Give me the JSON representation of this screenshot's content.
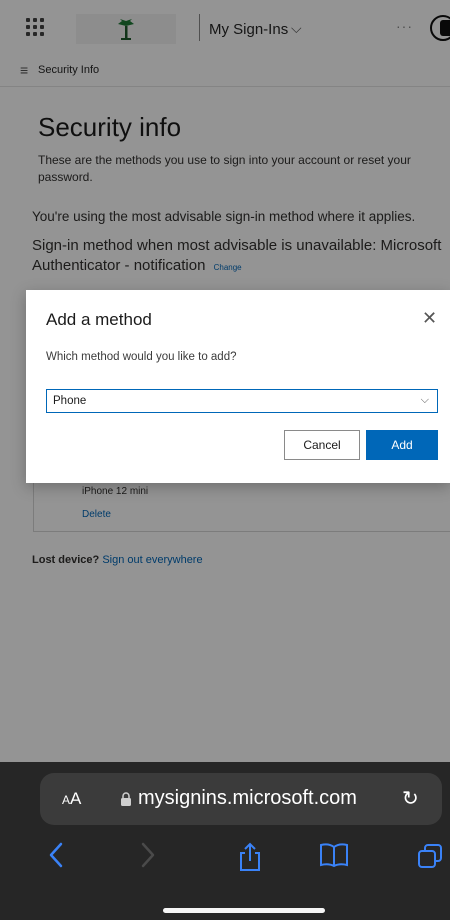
{
  "topbar": {
    "app_title": "My Sign-Ins",
    "chevron": "⌵",
    "more": "···"
  },
  "subbar": {
    "menu_glyph": "≡",
    "title": "Security Info"
  },
  "main": {
    "heading": "Security info",
    "description": "These are the methods you use to sign into your account or reset your password.",
    "advisable_text": "You're using the most advisable sign-in method where it applies.",
    "signin_method_text": "Sign-in method when most advisable is unavailable: Microsoft Authenticator - notification",
    "change_link": "Change",
    "method_card": {
      "device_name": "iPhone 12 mini",
      "delete_label": "Delete"
    },
    "lost_device_label": "Lost device?",
    "sign_out_everywhere": "Sign out everywhere"
  },
  "dialog": {
    "title": "Add a method",
    "close_glyph": "✕",
    "question": "Which method would you like to add?",
    "selected_method": "Phone",
    "cancel_label": "Cancel",
    "add_label": "Add",
    "accent_color": "#0067b8"
  },
  "safari": {
    "aa_big": "A",
    "aa_small": "A",
    "url": "mysignins.microsoft.com",
    "reload_glyph": "↻",
    "tint_color": "#3a82f7"
  }
}
